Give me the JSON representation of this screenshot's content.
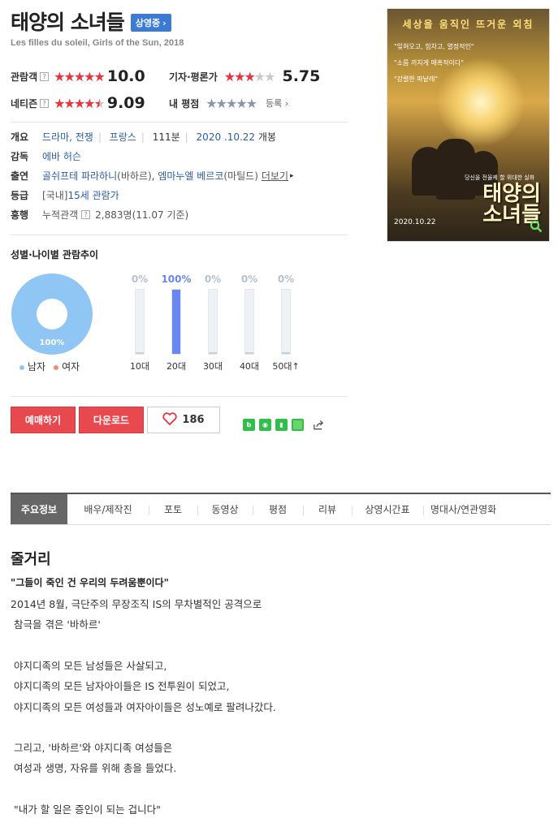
{
  "header": {
    "title": "태양의 소녀들",
    "status_badge": "상영중",
    "original_title": "Les filles du soleil, Girls of the Sun, 2018"
  },
  "ratings": {
    "audience": {
      "label": "관람객",
      "score": "10.0",
      "stars": 5
    },
    "critics": {
      "label": "기자·평론가",
      "score": "5.75",
      "stars": 3
    },
    "netizen": {
      "label": "네티즌",
      "score": "9.09",
      "stars": 4.5
    },
    "mine": {
      "label": "내 평점",
      "action": "등록"
    }
  },
  "info": {
    "overview_key": "개요",
    "genres": "드라마, 전쟁",
    "country": "프랑스",
    "runtime": "111분",
    "release_date": "2020 .10.22",
    "release_suffix": "개봉",
    "director_key": "감독",
    "director": "에바 허슨",
    "cast_key": "출연",
    "cast_1": "골쉬프테 파라하니",
    "cast_1_role": "(바하르)",
    "cast_sep": ",",
    "cast_2": "엠마누엘 베르코",
    "cast_2_role": "(마틸드)",
    "more": "더보기",
    "rating_key": "등급",
    "rating_prefix": "[국내]",
    "rating": "15세 관람가",
    "box_key": "흥행",
    "box_label": "누적관객",
    "box_value": "2,883명(11.07 기준)"
  },
  "poster": {
    "top_text": "세상을 움직인 뜨거운 외침",
    "quote1": "\"잊혀오고, 힘차고, 열정적인\"",
    "quote2": "\"소름 끼치게 매혹적이다\"",
    "quote3": "\"강렬한 파낱레\"",
    "tagline": "당신을 전율케 할 위대한 실화",
    "big_title_1": "태양의",
    "big_title_2": "소녀들",
    "date": "2020.10.22",
    "search_icon": "search-icon"
  },
  "demographics": {
    "title": "성별·나이별 관람추이",
    "gender": {
      "male_pct": "100%",
      "male_label": "남자",
      "female_label": "여자",
      "male_color": "#8fc6f3",
      "female_color": "#f08a7c"
    },
    "ages": [
      {
        "label": "10대",
        "pct": "0%",
        "value": 0
      },
      {
        "label": "20대",
        "pct": "100%",
        "value": 100
      },
      {
        "label": "30대",
        "pct": "0%",
        "value": 0
      },
      {
        "label": "40대",
        "pct": "0%",
        "value": 0
      },
      {
        "label": "50대↑",
        "pct": "0%",
        "value": 0
      }
    ]
  },
  "actions": {
    "reserve": "예매하기",
    "download": "다운로드",
    "likes": "186"
  },
  "tabs": [
    "주요정보",
    "배우/제작진",
    "포토",
    "동영상",
    "평점",
    "리뷰",
    "상영시간표",
    "명대사/연관영화"
  ],
  "story": {
    "heading": "줄거리",
    "tagline": "\"그들이 죽인 건 우리의 두려움뿐이다\"",
    "lines": [
      "2014년 8월, 극단주의 무장조직 IS의 무차별적인 공격으로",
      " 참극을 겪은 '바하르'",
      "",
      " 야지디족의 모든 남성들은 사살되고,",
      " 야지디족의 모든 남자아이들은 IS 전투원이 되었고,",
      " 야지디족의 모든 여성들과 여자아이들은 성노예로 팔려나갔다.",
      "",
      " 그리고, '바하르'와 야지디족 여성들은",
      " 여성과 생명, 자유를 위해 총을 들었다.",
      "",
      " \"내가 할 일은 증인이 되는 겁니다\""
    ]
  }
}
